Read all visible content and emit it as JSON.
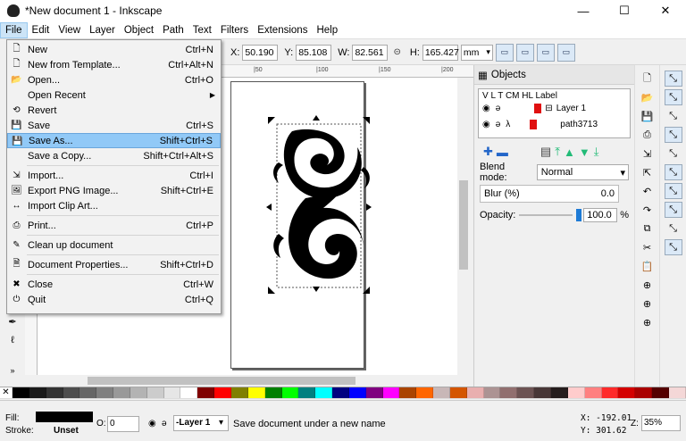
{
  "window": {
    "title": "*New document 1 - Inkscape",
    "minimize": "—",
    "maximize": "☐",
    "close": "✕"
  },
  "menubar": [
    "File",
    "Edit",
    "View",
    "Layer",
    "Object",
    "Path",
    "Text",
    "Filters",
    "Extensions",
    "Help"
  ],
  "toolbar": {
    "x_label": "X:",
    "x": "50.190",
    "y_label": "Y:",
    "y": "85.108",
    "w_label": "W:",
    "w": "82.561",
    "h_label": "H:",
    "h": "165.427",
    "unit": "mm"
  },
  "file_menu": [
    {
      "label": "New",
      "shortcut": "Ctrl+N",
      "icon": "new-doc-icon"
    },
    {
      "label": "New from Template...",
      "shortcut": "Ctrl+Alt+N",
      "icon": "template-icon"
    },
    {
      "label": "Open...",
      "shortcut": "Ctrl+O",
      "icon": "folder-open-icon"
    },
    {
      "label": "Open Recent",
      "shortcut": "",
      "icon": "",
      "submenu": true
    },
    {
      "label": "Revert",
      "shortcut": "",
      "icon": "revert-icon"
    },
    {
      "label": "Save",
      "shortcut": "Ctrl+S",
      "icon": "save-icon"
    },
    {
      "label": "Save As...",
      "shortcut": "Shift+Ctrl+S",
      "icon": "save-as-icon",
      "highlighted": true
    },
    {
      "label": "Save a Copy...",
      "shortcut": "Shift+Ctrl+Alt+S",
      "icon": ""
    },
    {
      "sep": true
    },
    {
      "label": "Import...",
      "shortcut": "Ctrl+I",
      "icon": "import-icon"
    },
    {
      "label": "Export PNG Image...",
      "shortcut": "Shift+Ctrl+E",
      "icon": "export-png-icon"
    },
    {
      "label": "Import Clip Art...",
      "shortcut": "",
      "icon": "clipart-icon"
    },
    {
      "sep": true
    },
    {
      "label": "Print...",
      "shortcut": "Ctrl+P",
      "icon": "print-icon"
    },
    {
      "sep": true
    },
    {
      "label": "Clean up document",
      "shortcut": "",
      "icon": "cleanup-icon"
    },
    {
      "sep": true
    },
    {
      "label": "Document Properties...",
      "shortcut": "Shift+Ctrl+D",
      "icon": "doc-properties-icon"
    },
    {
      "sep": true
    },
    {
      "label": "Close",
      "shortcut": "Ctrl+W",
      "icon": "close-doc-icon"
    },
    {
      "label": "Quit",
      "shortcut": "Ctrl+Q",
      "icon": "quit-icon"
    }
  ],
  "objects_panel": {
    "title": "Objects",
    "columns": "V  L  T  CM HL Label",
    "rows": [
      {
        "label": "Layer 1",
        "color": "#e01010"
      },
      {
        "label": "path3713",
        "color": "#e01010"
      }
    ],
    "blend_label": "Blend mode:",
    "blend_value": "Normal",
    "blur_label": "Blur (%)",
    "blur_value": "0.0",
    "opacity_label": "Opacity:",
    "opacity_value": "100.0",
    "opacity_unit": "%"
  },
  "ruler_ticks": [
    "|50",
    "|100",
    "|150",
    "|200"
  ],
  "status": {
    "fill_label": "Fill:",
    "stroke_label": "Stroke:",
    "stroke_value": "Unset",
    "o_label": "O:",
    "o_value": "0",
    "layer": "-Layer 1",
    "message": "Save document under a new name",
    "x_coord": "X: -192.01",
    "y_coord": "Y:  301.62",
    "zoom_label": "Z:",
    "zoom": "35%"
  },
  "palette": [
    "#000000",
    "#1a1a1a",
    "#333333",
    "#4d4d4d",
    "#666666",
    "#808080",
    "#999999",
    "#b3b3b3",
    "#cccccc",
    "#e6e6e6",
    "#ffffff",
    "#800000",
    "#ff0000",
    "#808000",
    "#ffff00",
    "#008000",
    "#00ff00",
    "#008080",
    "#00ffff",
    "#000080",
    "#0000ff",
    "#800080",
    "#ff00ff",
    "#aa4400",
    "#ff6600",
    "#c8b7b7",
    "#d45500",
    "#e9afaf",
    "#ac9393",
    "#916f6f",
    "#6c5353",
    "#483737",
    "#241c1c",
    "#ffcccc",
    "#ff8080",
    "#ff2a2a",
    "#d40000",
    "#aa0000",
    "#550000",
    "#f4d7d7"
  ]
}
